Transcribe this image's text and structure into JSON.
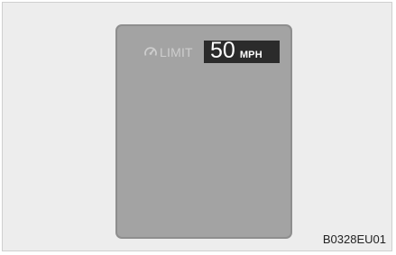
{
  "display": {
    "limit_label": "LIMIT",
    "speed_value": "50",
    "speed_unit": "MPH",
    "icon": "speed-limiter-icon"
  },
  "figure_code": "B0328EU01",
  "colors": {
    "background": "#ededed",
    "display_panel": "#a3a3a3",
    "speed_box": "#2b2b2b",
    "label_text": "#cdcdcd"
  }
}
